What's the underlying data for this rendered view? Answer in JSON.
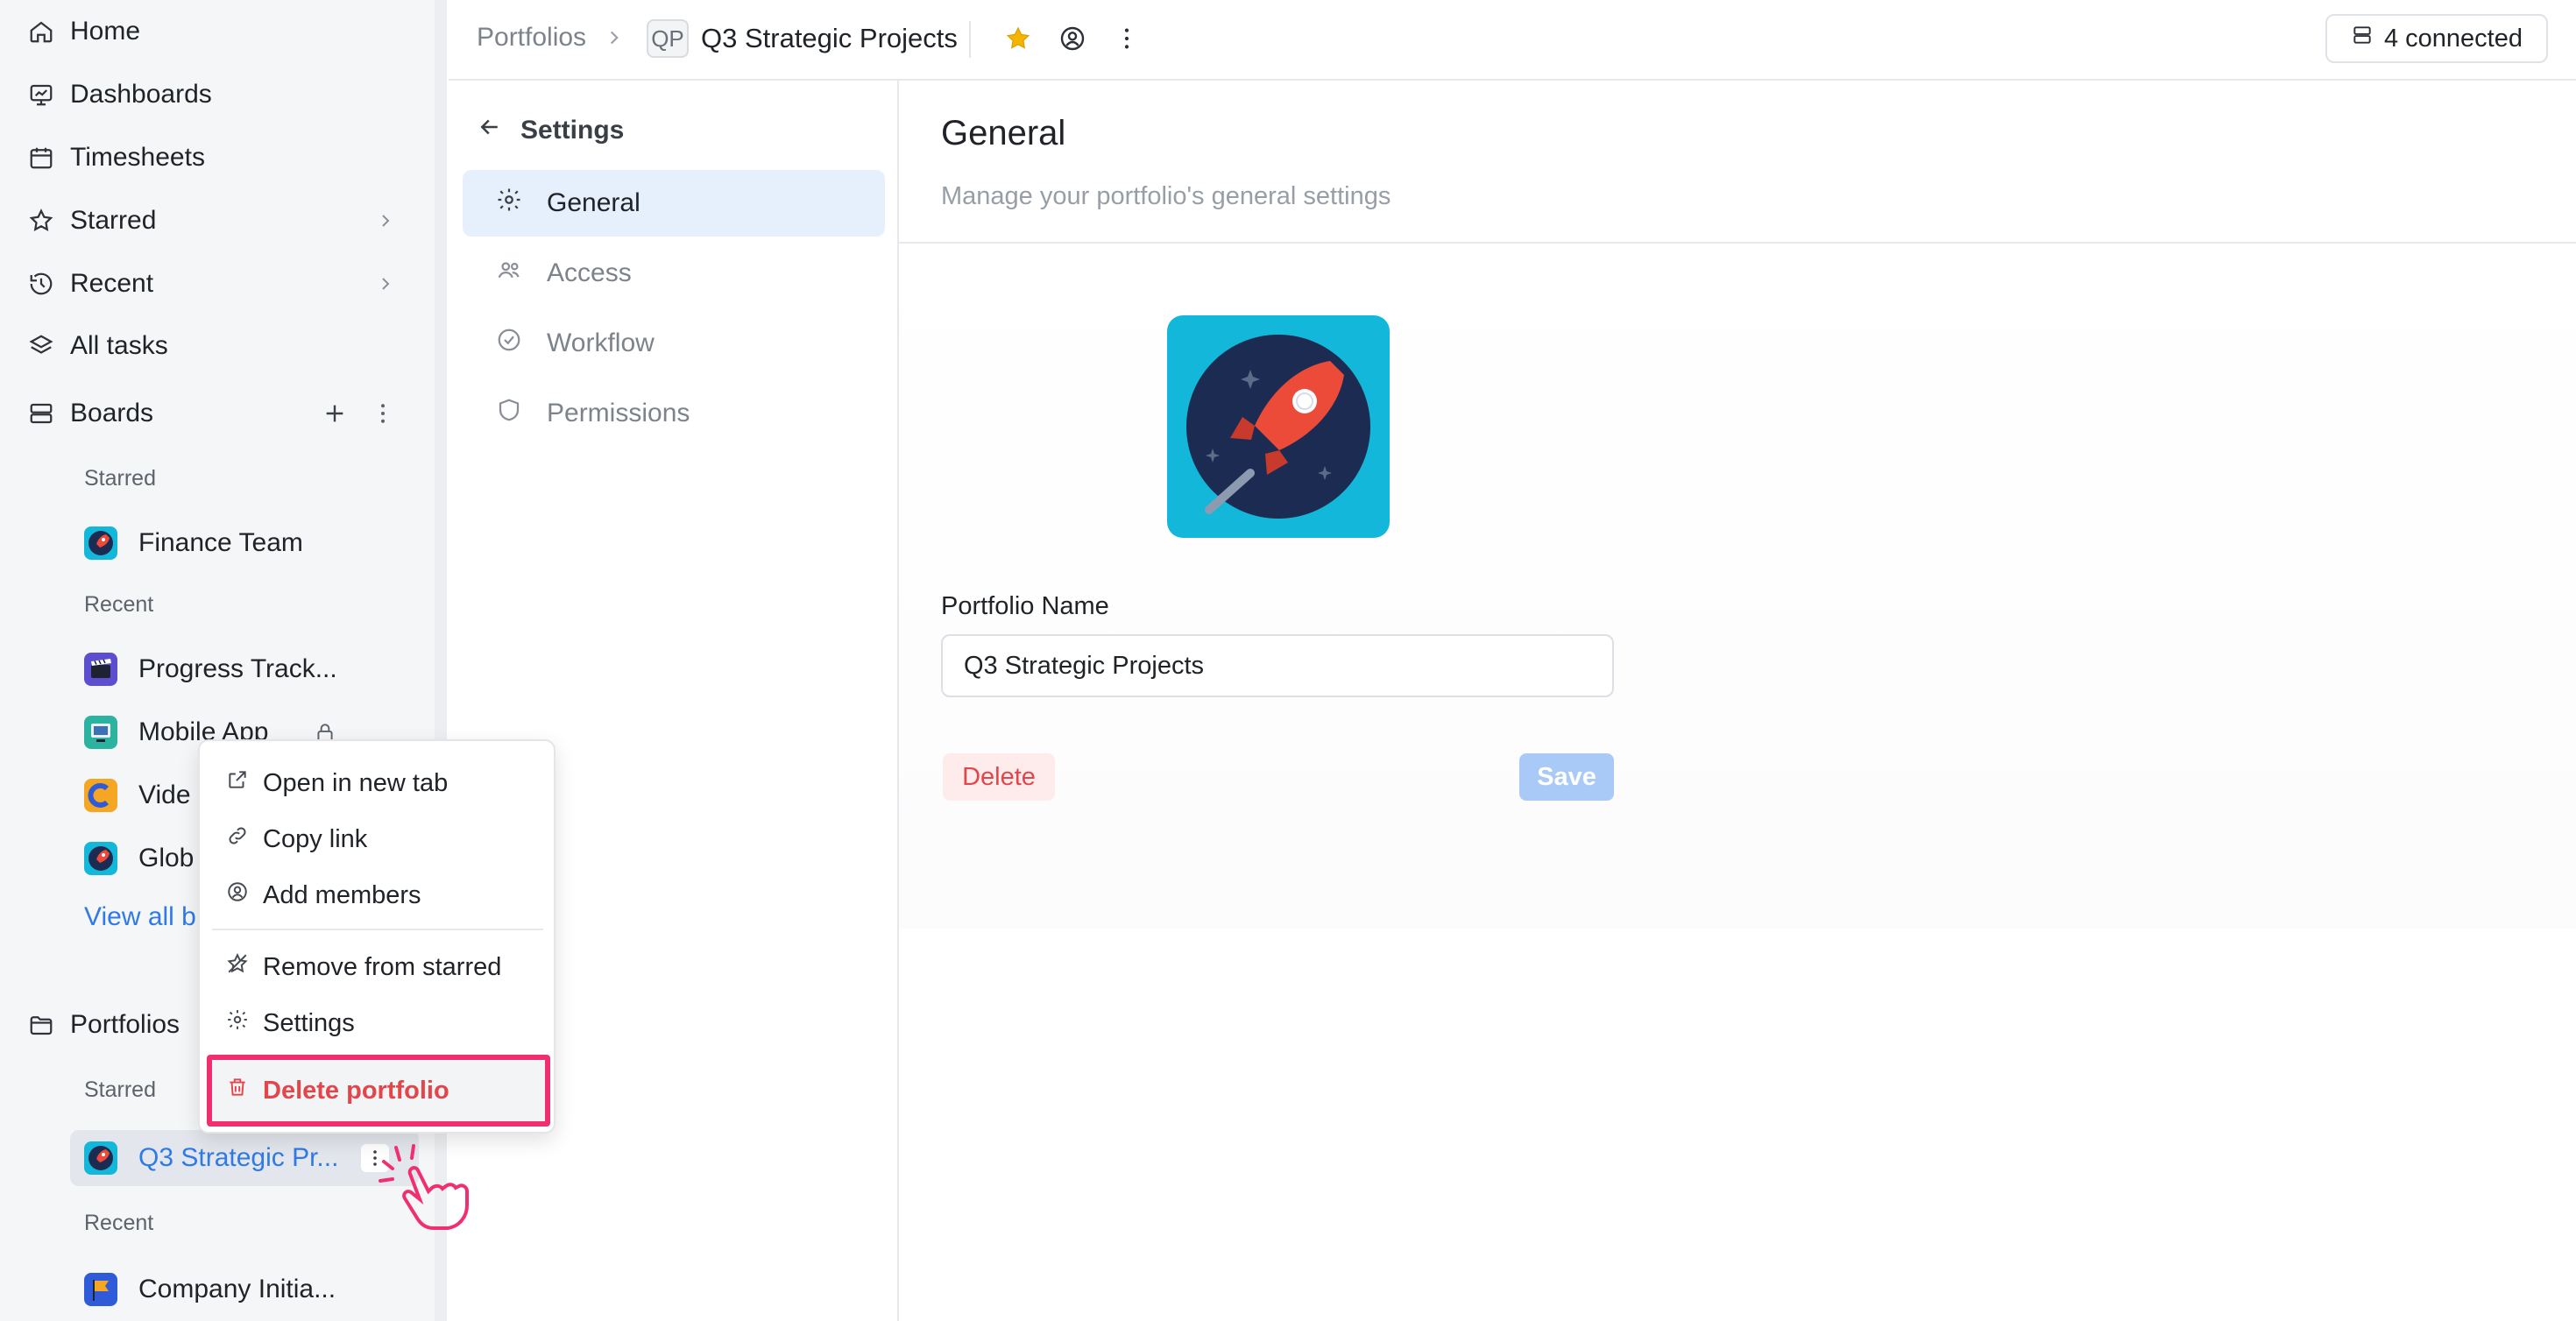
{
  "sidebar": {
    "nav": [
      {
        "label": "Home",
        "icon": "home-icon"
      },
      {
        "label": "Dashboards",
        "icon": "dashboard-icon"
      },
      {
        "label": "Timesheets",
        "icon": "calendar-icon"
      },
      {
        "label": "Starred",
        "icon": "star-icon"
      },
      {
        "label": "Recent",
        "icon": "history-icon"
      },
      {
        "label": "All tasks",
        "icon": "layers-icon"
      }
    ],
    "boards": {
      "label": "Boards",
      "starred_label": "Starred",
      "recent_label": "Recent",
      "starred": [
        {
          "label": "Finance Team",
          "icon": "rocket-icon"
        }
      ],
      "recent": [
        {
          "label": "Progress Track...",
          "icon": "clapper-icon"
        },
        {
          "label": "Mobile App",
          "icon": "monitor-icon"
        },
        {
          "label": "Vide",
          "icon": "c-logo-icon"
        },
        {
          "label": "Glob",
          "icon": "rocket-icon"
        }
      ],
      "view_all": "View all b"
    },
    "portfolios": {
      "label": "Portfolios",
      "starred_label": "Starred",
      "recent_label": "Recent",
      "starred": [
        {
          "label": "Q3 Strategic Pr...",
          "icon": "rocket-icon"
        }
      ],
      "recent": [
        {
          "label": "Company Initia...",
          "icon": "flag-icon"
        }
      ]
    }
  },
  "topbar": {
    "breadcrumb_root": "Portfolios",
    "badge": "QP",
    "title": "Q3 Strategic Projects",
    "connected": "4 connected"
  },
  "settings": {
    "title": "Settings",
    "items": [
      {
        "label": "General",
        "icon": "gear-icon",
        "active": true
      },
      {
        "label": "Access",
        "icon": "users-icon",
        "active": false
      },
      {
        "label": "Workflow",
        "icon": "check-circle-icon",
        "active": false
      },
      {
        "label": "Permissions",
        "icon": "shield-icon",
        "active": false
      }
    ]
  },
  "main": {
    "title": "General",
    "subtitle": "Manage your portfolio's general settings",
    "name_label": "Portfolio Name",
    "name_value": "Q3 Strategic Projects",
    "delete_label": "Delete",
    "save_label": "Save"
  },
  "context_menu": {
    "items": [
      {
        "label": "Open in new tab",
        "icon": "external-link-icon"
      },
      {
        "label": "Copy link",
        "icon": "link-icon"
      },
      {
        "label": "Add members",
        "icon": "add-member-icon"
      },
      {
        "label": "Remove from starred",
        "icon": "star-off-icon"
      },
      {
        "label": "Settings",
        "icon": "gear-icon"
      },
      {
        "label": "Delete portfolio",
        "icon": "trash-icon"
      }
    ]
  },
  "colors": {
    "accent": "#2f7ae5",
    "danger": "#e2454a",
    "highlight": "#f0306e",
    "star": "#f5b400"
  }
}
